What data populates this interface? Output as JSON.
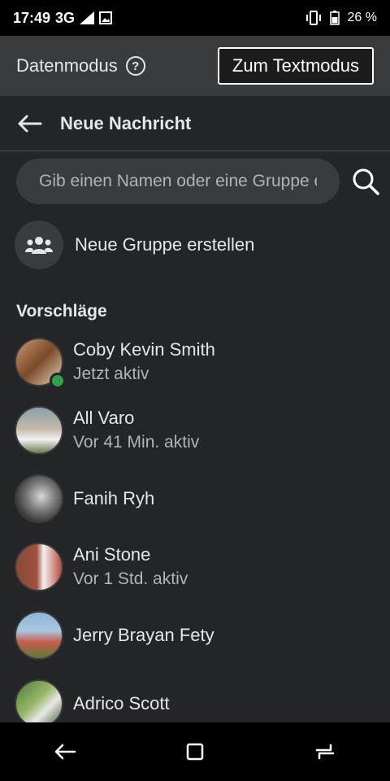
{
  "status_bar": {
    "time": "17:49",
    "network": "3G",
    "network_sup": "3G",
    "battery": "26 %"
  },
  "data_mode": {
    "title": "Datenmodus",
    "help": "?",
    "text_mode_label": "Zum Textmodus"
  },
  "header": {
    "title": "Neue Nachricht"
  },
  "search": {
    "placeholder": "Gib einen Namen oder eine Gruppe ein"
  },
  "group": {
    "label": "Neue Gruppe erstellen"
  },
  "suggestions": {
    "title": "Vorschläge",
    "contacts": [
      {
        "name": "Coby Kevin Smith",
        "status": "Jetzt aktiv",
        "online": true
      },
      {
        "name": "All Varo",
        "status": "Vor 41 Min. aktiv",
        "online": false
      },
      {
        "name": "Fanih Ryh",
        "status": "",
        "online": false
      },
      {
        "name": "Ani Stone",
        "status": "Vor 1 Std. aktiv",
        "online": false
      },
      {
        "name": "Jerry Brayan Fety",
        "status": "",
        "online": false
      },
      {
        "name": "Adrico Scott",
        "status": "",
        "online": false
      }
    ]
  },
  "colors": {
    "background": "#242526",
    "online": "#31a24c",
    "panel": "#3a3b3c"
  }
}
